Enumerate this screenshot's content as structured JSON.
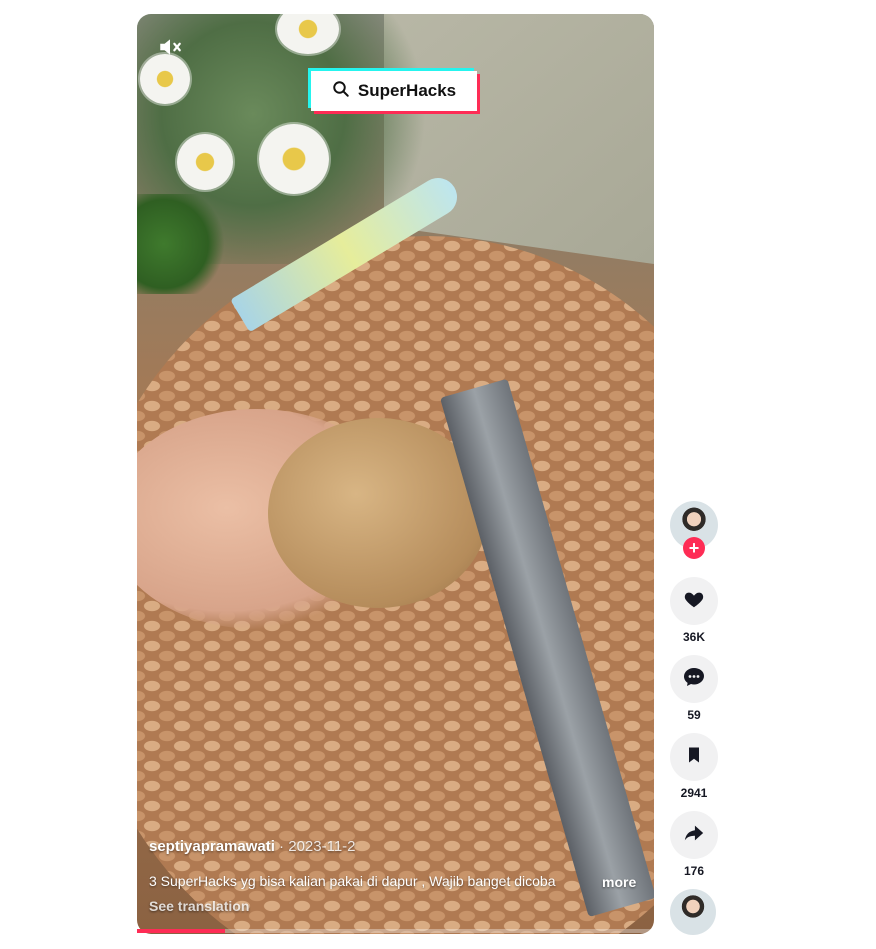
{
  "video": {
    "overlay_brand": "SuperHacks",
    "author": "septiyapramawati",
    "date_separator": " · ",
    "date": "2023-11-2",
    "caption": "3 SuperHacks yg bisa kalian pakai di dapur , Wajib banget dicoba",
    "more_label": "more",
    "see_translation": "See translation",
    "progress_percent": 17,
    "muted": true
  },
  "actions": {
    "likes": "36K",
    "comments": "59",
    "saves": "2941",
    "shares": "176"
  },
  "icons": {
    "mute": "speaker-muted-icon",
    "search": "search-icon",
    "like": "heart-icon",
    "comment": "comment-icon",
    "save": "bookmark-icon",
    "share": "share-arrow-icon",
    "follow": "plus-icon"
  },
  "colors": {
    "accent": "#fe2c55",
    "cyan": "#25f4ee",
    "action_bg": "#f1f1f2",
    "count_text": "#161823"
  }
}
